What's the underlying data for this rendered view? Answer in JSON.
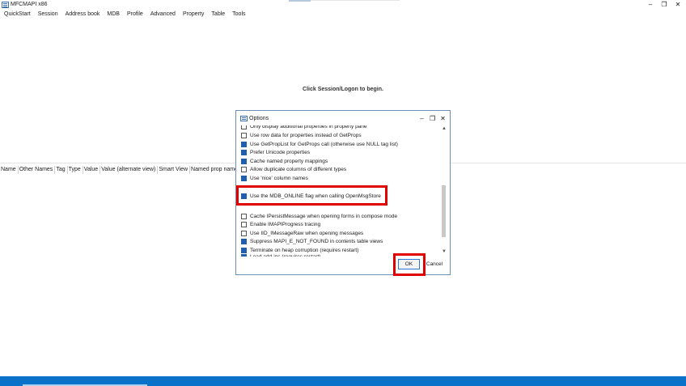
{
  "window": {
    "title": "MFCMAPI x86",
    "minimize": "–",
    "maximize": "❐",
    "close": "✕"
  },
  "menubar": [
    "QuickStart",
    "Session",
    "Address book",
    "MDB",
    "Profile",
    "Advanced",
    "Property",
    "Table",
    "Tools"
  ],
  "main": {
    "message": "Click Session/Logon to begin.",
    "columns": [
      "Name",
      "Other Names",
      "Tag",
      "Type",
      "Value",
      "Value (alternate view)",
      "Smart View",
      "Named prop name"
    ]
  },
  "dialog": {
    "title": "Options",
    "minimize": "–",
    "maximize": "❐",
    "close": "✕",
    "options": [
      {
        "label": "Only display additional properties in property pane",
        "checked": false,
        "partial": "top"
      },
      {
        "label": "Use row data for properties instead of GetProps",
        "checked": false
      },
      {
        "label": "Use GetPropList for GetProps call (otherwise use NULL tag list)",
        "checked": true
      },
      {
        "label": "Prefer Unicode properties",
        "checked": true
      },
      {
        "label": "Cache named property mappings",
        "checked": true
      },
      {
        "label": "Allow duplicate columns of different types",
        "checked": false
      },
      {
        "label": "Use 'nice' column names",
        "checked": true
      },
      {
        "label": "Use the MDB_ONLINE flag when calling OpenMsgStore",
        "checked": true
      },
      {
        "label": "Cache IPersistMessage when opening forms in compose mode",
        "checked": false
      },
      {
        "label": "Enable IMAPIProgress tracing",
        "checked": false
      },
      {
        "label": "Use IID_IMessageRaw when opening messages",
        "checked": false
      },
      {
        "label": "Suppress MAPI_E_NOT_FOUND in contents table views",
        "checked": true
      },
      {
        "label": "Terminate on heap corruption (requires restart)",
        "checked": true
      },
      {
        "label": "Load add-ins (requires restart)",
        "checked": true,
        "partial": "bottom"
      }
    ],
    "scroll_up": "▲",
    "scroll_down": "▼",
    "ok_label": "OK",
    "cancel_label": "Cancel"
  },
  "colors": {
    "accent": "#1f5fae",
    "highlight": "#e00000",
    "taskbar": "#0a72c8"
  }
}
